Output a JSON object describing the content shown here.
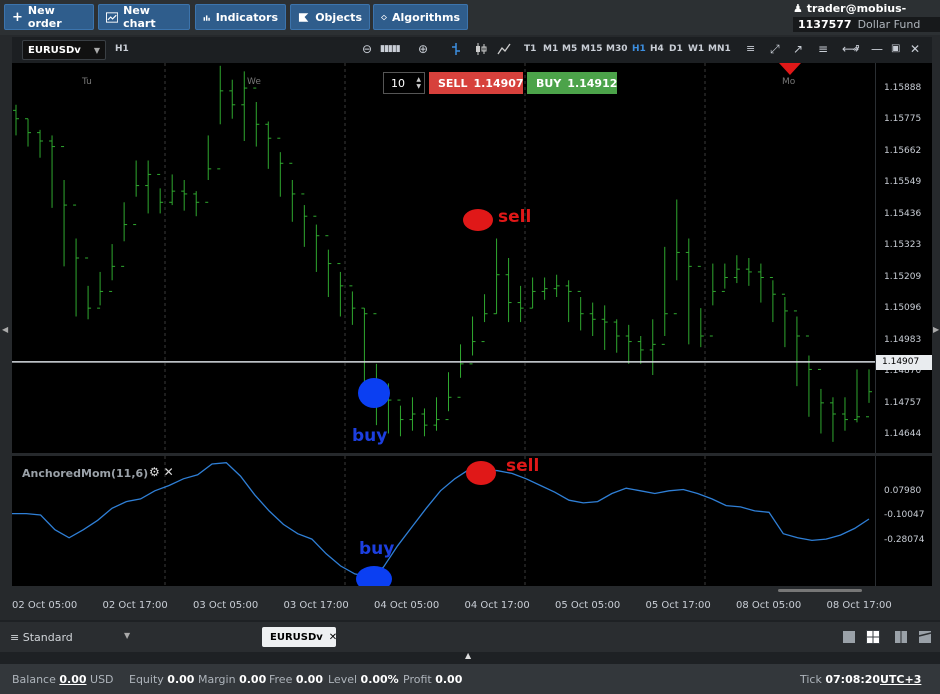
{
  "toolbar": {
    "new_order": "New order",
    "new_chart": "New chart",
    "indicators": "Indicators",
    "objects": "Objects",
    "algorithms": "Algorithms"
  },
  "account": {
    "user": "trader@mobius-soft.org",
    "number": "1137577",
    "fund": "Dollar Fund"
  },
  "chart_toolbar": {
    "symbol": "EURUSDv",
    "timeframe": "H1",
    "timeframes": [
      "T1",
      "M1",
      "M5",
      "M15",
      "M30",
      "H1",
      "H4",
      "D1",
      "W1",
      "MN1"
    ],
    "active_timeframe": "H1"
  },
  "order": {
    "quantity": "10",
    "sell_label": "SELL",
    "sell_price": "1.14907",
    "buy_label": "BUY",
    "buy_price": "1.14912"
  },
  "indicator": {
    "label": "AnchoredMom(11,6)"
  },
  "annotations": {
    "sell_main": "sell",
    "buy_main": "buy",
    "sell_sub": "sell",
    "buy_sub": "buy"
  },
  "colors": {
    "candle": "#2fa82f",
    "indicator_line": "#2f7fd6",
    "sell_marker": "#e01818",
    "buy_marker": "#0b3ff2",
    "sell_button": "#d7413c",
    "buy_button": "#4ca34a"
  },
  "chart_data": [
    {
      "type": "ohlc",
      "symbol": "EURUSDv",
      "timeframe": "H1",
      "y_ticks": [
        "1.15888",
        "1.15775",
        "1.15662",
        "1.15549",
        "1.15436",
        "1.15323",
        "1.15209",
        "1.15096",
        "1.14983",
        "1.14870",
        "1.14757",
        "1.14644"
      ],
      "ylim": [
        1.1458,
        1.1598
      ],
      "current_price": "1.14907",
      "day_labels": [
        "Tu",
        "We",
        "Mo"
      ],
      "x_ticks": [
        "02 Oct 05:00",
        "02 Oct 17:00",
        "03 Oct 05:00",
        "03 Oct 17:00",
        "04 Oct 05:00",
        "04 Oct 17:00",
        "05 Oct 05:00",
        "05 Oct 17:00",
        "08 Oct 05:00",
        "08 Oct 17:00"
      ],
      "close": [
        1.1578,
        1.1573,
        1.157,
        1.1568,
        1.1547,
        1.1528,
        1.151,
        1.1516,
        1.1525,
        1.154,
        1.1554,
        1.1558,
        1.1548,
        1.1552,
        1.1551,
        1.1548,
        1.156,
        1.1588,
        1.1583,
        1.1589,
        1.1576,
        1.1571,
        1.1562,
        1.1551,
        1.1543,
        1.1536,
        1.1526,
        1.1518,
        1.151,
        1.1508,
        1.1482,
        1.1477,
        1.147,
        1.1472,
        1.1468,
        1.147,
        1.1478,
        1.149,
        1.1498,
        1.1508,
        1.1522,
        1.1512,
        1.151,
        1.1516,
        1.1517,
        1.1518,
        1.1516,
        1.1508,
        1.1506,
        1.1505,
        1.15,
        1.1498,
        1.1495,
        1.1497,
        1.1508,
        1.153,
        1.1525,
        1.15,
        1.1516,
        1.1521,
        1.1524,
        1.1523,
        1.1521,
        1.1515,
        1.1509,
        1.15,
        1.1488,
        1.1476,
        1.1472,
        1.147,
        1.1471,
        1.148
      ],
      "high": [
        1.1583,
        1.1578,
        1.1574,
        1.1572,
        1.1556,
        1.1535,
        1.1518,
        1.1523,
        1.1533,
        1.1548,
        1.1563,
        1.1563,
        1.1553,
        1.1558,
        1.1556,
        1.1552,
        1.1572,
        1.1597,
        1.1592,
        1.1595,
        1.1584,
        1.1577,
        1.1566,
        1.1556,
        1.1547,
        1.154,
        1.1531,
        1.1523,
        1.1516,
        1.151,
        1.149,
        1.1483,
        1.1475,
        1.1478,
        1.1474,
        1.1478,
        1.1487,
        1.1497,
        1.1507,
        1.1515,
        1.1535,
        1.1528,
        1.1518,
        1.1521,
        1.1521,
        1.1522,
        1.152,
        1.1514,
        1.1512,
        1.1511,
        1.1506,
        1.1504,
        1.15,
        1.1506,
        1.1532,
        1.1549,
        1.1535,
        1.151,
        1.1526,
        1.1526,
        1.1529,
        1.1528,
        1.1526,
        1.152,
        1.1514,
        1.1507,
        1.1493,
        1.1481,
        1.1478,
        1.1478,
        1.1488,
        1.1488
      ],
      "low": [
        1.1572,
        1.1568,
        1.1564,
        1.1546,
        1.1525,
        1.1507,
        1.1506,
        1.1511,
        1.152,
        1.1534,
        1.155,
        1.1544,
        1.1544,
        1.1547,
        1.1545,
        1.1543,
        1.1556,
        1.1576,
        1.1578,
        1.157,
        1.1568,
        1.156,
        1.155,
        1.1541,
        1.1532,
        1.1523,
        1.1514,
        1.1507,
        1.1504,
        1.148,
        1.1468,
        1.1465,
        1.1464,
        1.1466,
        1.1464,
        1.1466,
        1.1473,
        1.1485,
        1.1493,
        1.1505,
        1.1508,
        1.1505,
        1.1505,
        1.151,
        1.1513,
        1.1514,
        1.1505,
        1.1502,
        1.15,
        1.1495,
        1.1494,
        1.149,
        1.149,
        1.1486,
        1.15,
        1.152,
        1.1497,
        1.1496,
        1.1511,
        1.1517,
        1.1519,
        1.1518,
        1.1512,
        1.1505,
        1.1496,
        1.1482,
        1.1471,
        1.1465,
        1.1462,
        1.1466,
        1.1469,
        1.1476
      ]
    },
    {
      "type": "line",
      "name": "AnchoredMom(11,6)",
      "y_ticks": [
        "0.07980",
        "-0.10047",
        "-0.28074"
      ],
      "ylim": [
        -0.62,
        0.35
      ],
      "values": [
        -0.08,
        -0.08,
        -0.09,
        -0.2,
        -0.26,
        -0.2,
        -0.13,
        -0.04,
        0.01,
        0.03,
        0.09,
        0.13,
        0.18,
        0.21,
        0.29,
        0.3,
        0.2,
        0.06,
        -0.06,
        -0.16,
        -0.23,
        -0.27,
        -0.38,
        -0.47,
        -0.53,
        -0.55,
        -0.48,
        -0.32,
        -0.18,
        -0.04,
        0.09,
        0.18,
        0.25,
        0.25,
        0.24,
        0.22,
        0.18,
        0.13,
        0.08,
        0.02,
        0.0,
        0.01,
        0.07,
        0.11,
        0.09,
        0.07,
        0.09,
        0.1,
        0.07,
        0.03,
        -0.02,
        -0.03,
        -0.06,
        -0.07,
        -0.23,
        -0.26,
        -0.28,
        -0.27,
        -0.24,
        -0.19,
        -0.12
      ]
    }
  ],
  "bottom": {
    "template": "Standard",
    "tab": "EURUSDv"
  },
  "status": {
    "balance_label": "Balance",
    "balance_value": "0.00",
    "balance_currency": "USD",
    "equity_label": "Equity",
    "equity_value": "0.00",
    "margin_label": "Margin",
    "margin_value": "0.00",
    "free_label": "Free",
    "free_value": "0.00",
    "level_label": "Level",
    "level_value": "0.00%",
    "profit_label": "Profit",
    "profit_value": "0.00",
    "tick_label": "Tick",
    "tick_value": "07:08:20",
    "timezone": "UTC+3"
  }
}
